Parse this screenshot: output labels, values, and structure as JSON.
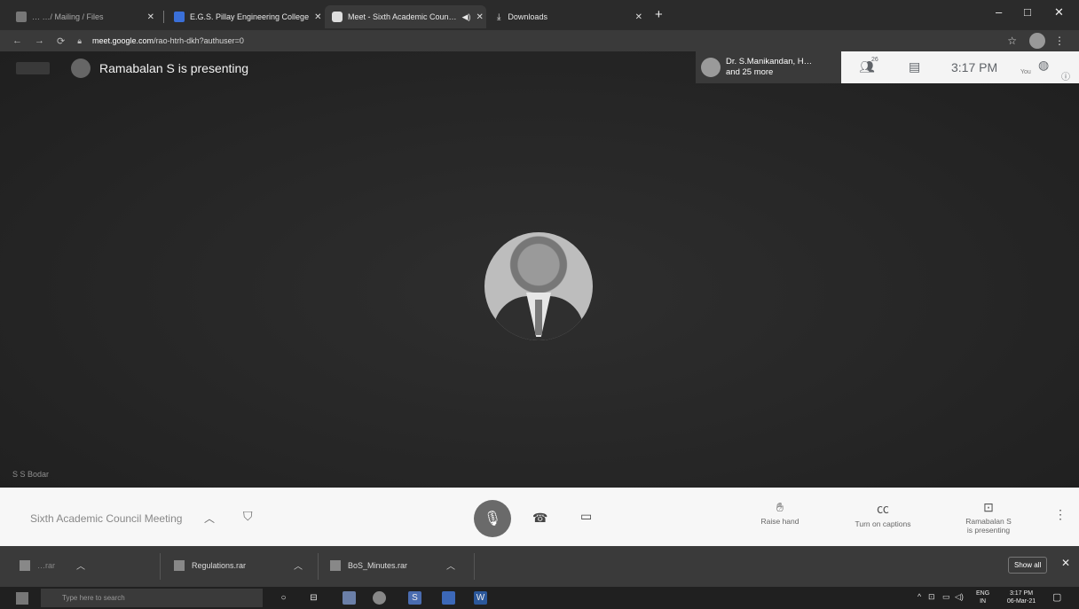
{
  "browser": {
    "tabs": [
      {
        "label": "… …/ Mailing / Files",
        "fav_color": "#777777"
      },
      {
        "label": "E.G.S. Pillay Engineering College",
        "fav_color": "#3a6fd8"
      },
      {
        "label": "Meet - Sixth Academic Coun…",
        "fav_color": "#e8e8e8"
      },
      {
        "label": "Downloads",
        "fav_color": "#e8e8e8"
      }
    ],
    "new_tab": "+",
    "window_controls": [
      "–",
      "□",
      "✕"
    ],
    "url_host": "meet.google.com",
    "url_path": "/rao-htrh-dkh?authuser=0"
  },
  "meet": {
    "presenting_text": "Ramabalan S is presenting",
    "participants_label": "Dr. S.Manikandan, H…",
    "participants_more": "and 25 more",
    "participants_count": "26",
    "time": "3:17 PM",
    "you_label": "You",
    "self_name_label": "S S Bodar"
  },
  "toolbar": {
    "meeting_title": "Sixth Academic Council Meeting",
    "raise_hand": "Raise hand",
    "captions": "Turn on captions",
    "presenting_line1": "Ramabalan S",
    "presenting_line2": "is presenting"
  },
  "downloads": {
    "items": [
      "…rar",
      "Regulations.rar",
      "BoS_Minutes.rar"
    ],
    "show_all": "Show all"
  },
  "taskbar": {
    "search_placeholder": "Type here to search",
    "lang1": "ENG",
    "lang2": "IN",
    "time": "3:17 PM",
    "date": "06-Mar-21"
  }
}
